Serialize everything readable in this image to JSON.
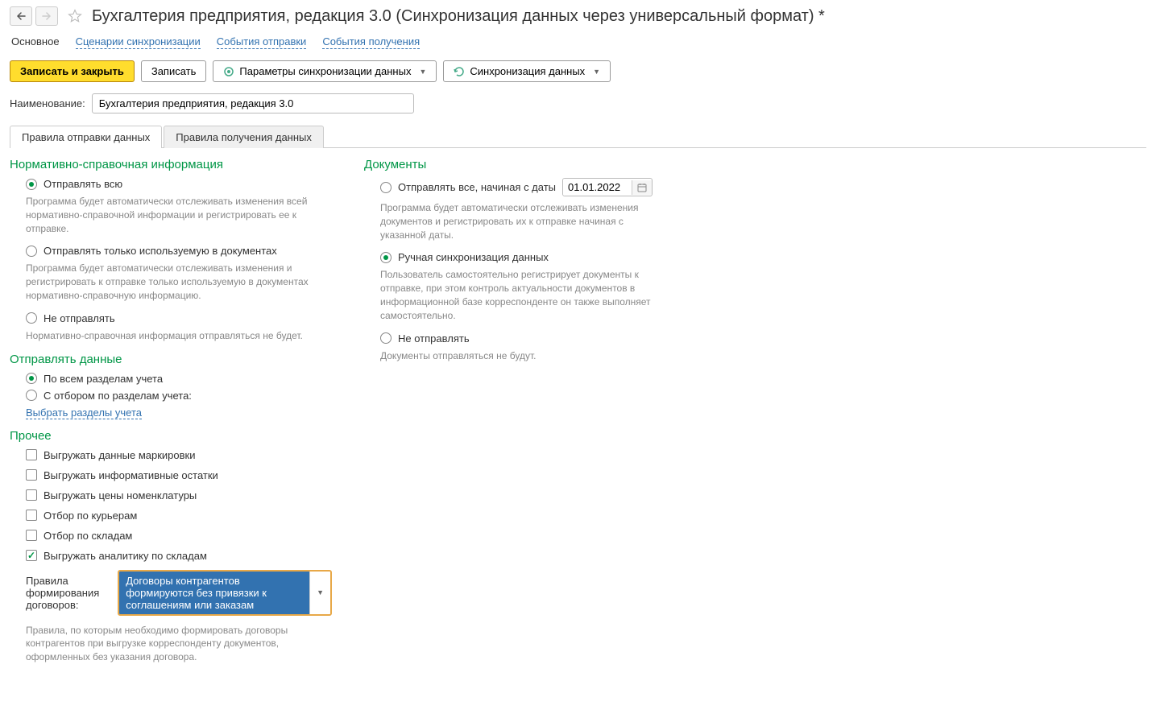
{
  "pageTitle": "Бухгалтерия предприятия, редакция 3.0 (Синхронизация данных через универсальный формат) *",
  "navTabs": {
    "main": "Основное",
    "scenarios": "Сценарии синхронизации",
    "sendEvents": "События отправки",
    "receiveEvents": "События получения"
  },
  "toolbar": {
    "saveClose": "Записать и закрыть",
    "save": "Записать",
    "syncParams": "Параметры синхронизации данных",
    "syncData": "Синхронизация данных"
  },
  "nameField": {
    "label": "Наименование:",
    "value": "Бухгалтерия предприятия, редакция 3.0"
  },
  "innerTabs": {
    "sendRules": "Правила отправки данных",
    "receiveRules": "Правила получения данных"
  },
  "nsi": {
    "title": "Нормативно-справочная информация",
    "sendAll": "Отправлять всю",
    "sendAllDesc": "Программа будет автоматически отслеживать изменения всей нормативно-справочной информации и регистрировать ее к отправке.",
    "sendUsed": "Отправлять только используемую в документах",
    "sendUsedDesc": "Программа будет автоматически отслеживать изменения и регистрировать к отправке только используемую в документах нормативно-справочную информацию.",
    "noSend": "Не отправлять",
    "noSendDesc": "Нормативно-справочная информация отправляться не будет."
  },
  "docs": {
    "title": "Документы",
    "sendAllFrom": "Отправлять все, начиная с даты",
    "dateValue": "01.01.2022",
    "sendAllFromDesc": "Программа будет автоматически отслеживать изменения документов и регистрировать их к отправке начиная с указанной даты.",
    "manualSync": "Ручная синхронизация данных",
    "manualSyncDesc": "Пользователь самостоятельно регистрирует документы к отправке, при этом контроль актуальности документов в информационной базе корреспонденте он также выполняет самостоятельно.",
    "noSend": "Не отправлять",
    "noSendDesc": "Документы отправляться не будут."
  },
  "sendData": {
    "title": "Отправлять данные",
    "allSections": "По всем разделам учета",
    "withFilter": "С отбором по разделам учета:",
    "selectSections": "Выбрать разделы учета"
  },
  "other": {
    "title": "Прочее",
    "exportMarking": "Выгружать данные маркировки",
    "exportInfoBalances": "Выгружать информативные остатки",
    "exportPrices": "Выгружать цены номенклатуры",
    "filterCouriers": "Отбор по курьерам",
    "filterWarehouses": "Отбор по складам",
    "exportWarehouseAnalytics": "Выгружать аналитику по складам",
    "contractRulesLabel": "Правила формирования договоров:",
    "contractRulesValue": "Договоры контрагентов формируются без привязки к соглашениям или заказам",
    "contractRulesDesc": "Правила, по которым необходимо формировать договоры контрагентов при выгрузке корреспонденту документов, оформленных без указания договора."
  }
}
